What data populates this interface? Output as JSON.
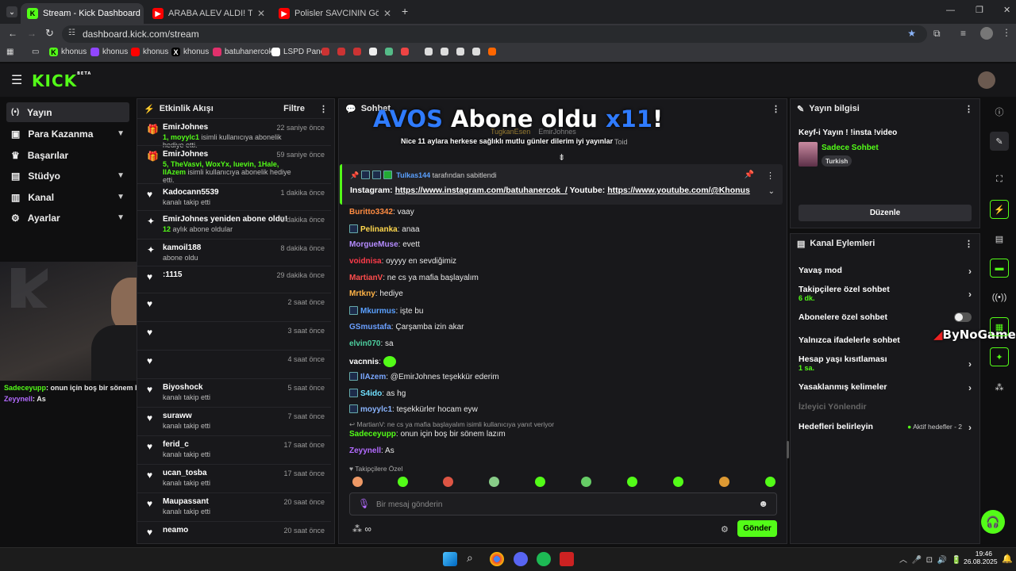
{
  "browser": {
    "tabs": [
      {
        "title": "Stream - Kick Dashboard",
        "icon": "kick-icon"
      },
      {
        "title": "ARABA ALEV ALDI! Türkiye'de Y",
        "icon": "youtube-icon"
      },
      {
        "title": "Polisler SAVCININ Gözünün Yaş",
        "icon": "youtube-icon"
      }
    ],
    "url": "dashboard.kick.com/stream",
    "bookmarks": [
      "khonus",
      "khonus",
      "khonus",
      "khonus",
      "batuhanercok",
      "LSPD Panel"
    ]
  },
  "kick": {
    "logo": "KICK",
    "logo_badge": "BETA"
  },
  "nav": [
    {
      "label": "Yayın",
      "icon": "broadcast-icon",
      "chevron": false
    },
    {
      "label": "Para Kazanma",
      "icon": "money-icon",
      "chevron": true
    },
    {
      "label": "Başarılar",
      "icon": "trophy-icon",
      "chevron": false
    },
    {
      "label": "Stüdyo",
      "icon": "studio-icon",
      "chevron": true
    },
    {
      "label": "Kanal",
      "icon": "channel-icon",
      "chevron": true
    },
    {
      "label": "Ayarlar",
      "icon": "settings-icon",
      "chevron": true
    }
  ],
  "activity": {
    "title": "Etkinlik Akışı",
    "filter": "Filtre",
    "items": [
      {
        "name": "EmirJohnes",
        "time": "22 saniye önce",
        "hl": "1, moyylc1",
        "desc": " isimli kullanıcıya abonelik hediye etti.",
        "icon": "gift-icon"
      },
      {
        "name": "EmirJohnes",
        "time": "59 saniye önce",
        "hl": "5, TheVasvi, WoxYx, luevin, 1Hale, IlAzem",
        "desc": " isimli kullanıcıya abonelik hediye etti.",
        "icon": "gift-icon"
      },
      {
        "name": "Kadocann5539",
        "time": "1 dakika önce",
        "hl": "",
        "desc": "kanalı takip etti",
        "icon": "heart-icon"
      },
      {
        "name": "EmirJohnes yeniden abone oldu!",
        "time": "5 dakika önce",
        "hl": "12",
        "desc": " aylık abone oldular",
        "icon": "sparkle-icon"
      },
      {
        "name": "kamoil188",
        "time": "8 dakika önce",
        "hl": "",
        "desc": "abone oldu",
        "icon": "sparkle-icon"
      },
      {
        "name": ":1115",
        "time": "29 dakika önce",
        "hl": "",
        "desc": "",
        "icon": "heart-icon"
      },
      {
        "name": "",
        "time": "2 saat önce",
        "hl": "",
        "desc": "",
        "icon": "heart-icon"
      },
      {
        "name": "",
        "time": "3 saat önce",
        "hl": "",
        "desc": "",
        "icon": "heart-icon"
      },
      {
        "name": "",
        "time": "4 saat önce",
        "hl": "",
        "desc": "",
        "icon": "heart-icon"
      },
      {
        "name": "Biyoshock",
        "time": "5 saat önce",
        "hl": "",
        "desc": "kanalı takip etti",
        "icon": "heart-icon"
      },
      {
        "name": "suraww",
        "time": "7 saat önce",
        "hl": "",
        "desc": "kanalı takip etti",
        "icon": "heart-icon"
      },
      {
        "name": "ferid_c",
        "time": "17 saat önce",
        "hl": "",
        "desc": "kanalı takip etti",
        "icon": "heart-icon"
      },
      {
        "name": "ucan_tosba",
        "time": "17 saat önce",
        "hl": "",
        "desc": "kanalı takip etti",
        "icon": "heart-icon"
      },
      {
        "name": "Maupassant",
        "time": "20 saat önce",
        "hl": "",
        "desc": "kanalı takip etti",
        "icon": "heart-icon"
      },
      {
        "name": "neamo",
        "time": "20 saat önce",
        "hl": "",
        "desc": "",
        "icon": "heart-icon"
      }
    ]
  },
  "webcam_chat": [
    {
      "user": "Sadeceyupp",
      "msg": ": onun için boş bir sönem lazım",
      "color": "#53fc18"
    },
    {
      "user": "Zeyynell",
      "msg": ": As",
      "color": "#b36bff"
    }
  ],
  "chat": {
    "title": "Sohbet",
    "overlay_title_a": "AVOS",
    "overlay_title_b": " Abone oldu ",
    "overlay_title_c": "x11",
    "overlay_title_d": "!",
    "overlay_sub": "Nice 11 aylara herkese sağlıklı mutlu günler dilerim iyi yayınlar",
    "overlay_names": [
      "TugkanEsen",
      "EmirJohnes",
      "Toid"
    ],
    "pinned_by": "Tulkas144",
    "pinned_suffix": " tarafından sabitlendi",
    "pinned_prefix": "Instagram: ",
    "pinned_link1": "https://www.instagram.com/batuhanercok_/",
    "pinned_mid": " Youtube: ",
    "pinned_link2": "https://www.youtube.com/@Khonus",
    "messages": [
      {
        "user": "Buritto3342",
        "msg": ": vaay",
        "color": "#ff8c42",
        "badge": false
      },
      {
        "user": "Pelinanka",
        "msg": ": anaa",
        "color": "#ffd84d",
        "badge": true
      },
      {
        "user": "MorgueMuse",
        "msg": ": evett",
        "color": "#b58cff",
        "badge": false
      },
      {
        "user": "voidnisa",
        "msg": ": oyyyy en sevdiğimiz",
        "color": "#ff3b4a",
        "badge": false
      },
      {
        "user": "MartianV",
        "msg": ": ne cs ya mafia başlayalım",
        "color": "#ff4d4d",
        "badge": false
      },
      {
        "user": "Mrtkny",
        "msg": ": hediye",
        "color": "#ffb347",
        "badge": false
      },
      {
        "user": "Mkurmus",
        "msg": ": işte bu",
        "color": "#5aa0ff",
        "badge": true
      },
      {
        "user": "GSmustafa",
        "msg": ": Çarşamba izin akar",
        "color": "#6a9fff",
        "badge": false
      },
      {
        "user": "elvin070",
        "msg": ": sa",
        "color": "#4dd0a0",
        "badge": false
      },
      {
        "user": "vacnnis",
        "msg": ": ",
        "color": "#ffffff",
        "badge": false
      },
      {
        "user": "IlAzem",
        "msg": ": @EmirJohnes teşekkür ederim",
        "color": "#7aa7ff",
        "badge": true
      },
      {
        "user": "S4ido",
        "msg": ": as hg",
        "color": "#70e0ff",
        "badge": true
      },
      {
        "user": "moyylc1",
        "msg": ": teşekkürler hocam eyw",
        "color": "#8ab4ff",
        "badge": true
      }
    ],
    "reply_note": "MartianV: ne cs ya mafia başlayalım isimli kullanıcıya yanıt veriyor",
    "reply_user": "Sadeceyupp",
    "reply_msg": ": onun için boş bir sönem lazım",
    "last_user": "Zeyynell",
    "last_msg": ": As",
    "followers_only": "Takipçilere Özel",
    "input_placeholder": "Bir mesaj gönderin",
    "send": "Gönder"
  },
  "stream_info": {
    "title": "Yayın bilgisi",
    "stream_title": "Keyf-i Yayın ! !insta !video",
    "category": "Sadece Sohbet",
    "tag": "Turkish",
    "edit": "Düzenle"
  },
  "channel_actions": {
    "title": "Kanal Eylemleri",
    "slow_mode": "Yavaş mod",
    "followers_chat": "Takipçilere özel sohbet",
    "followers_chat_sub": "6 dk.",
    "subs_chat": "Abonelere özel sohbet",
    "emote_chat": "Yalnızca ifadelerle sohbet",
    "age_limit": "Hesap yaşı kısıtlaması",
    "age_limit_sub": "1 sa.",
    "banned_words": "Yasaklanmış kelimeler",
    "viewer_redirect": "İzleyici Yönlendir",
    "goals": "Hedefleri belirleyin",
    "goals_status": "Aktif hedefler - 2"
  },
  "watermark": "ByNoGame",
  "taskbar": {
    "time": "19:46",
    "date": "26.08.2025"
  },
  "colors": {
    "kick_green": "#53fc18",
    "panel": "#18181b",
    "bg": "#0f0f10"
  }
}
